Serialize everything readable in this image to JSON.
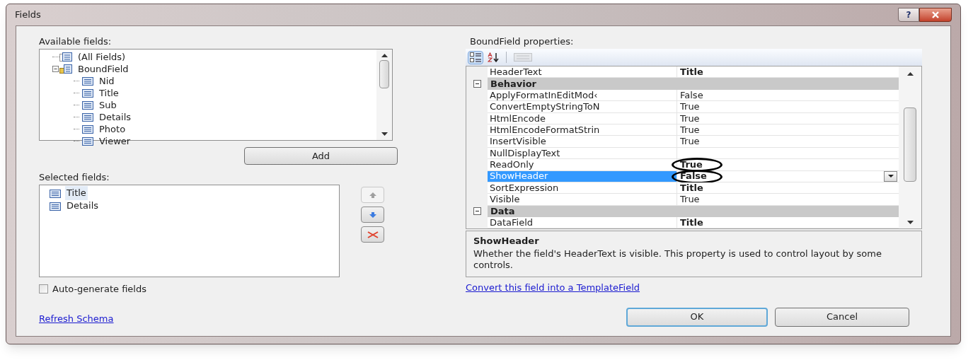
{
  "window": {
    "title": "Fields",
    "help_button": "?"
  },
  "available_fields": {
    "label": "Available fields:",
    "tree": [
      {
        "label": "(All Fields)",
        "kind": "all"
      },
      {
        "label": "BoundField",
        "kind": "folder",
        "expanded": true,
        "children": [
          {
            "label": "Nid",
            "kind": "field"
          },
          {
            "label": "Title",
            "kind": "field"
          },
          {
            "label": "Sub",
            "kind": "field"
          },
          {
            "label": "Details",
            "kind": "field"
          },
          {
            "label": "Photo",
            "kind": "field"
          },
          {
            "label": "Viewer",
            "kind": "field"
          }
        ]
      }
    ]
  },
  "add_button": "Add",
  "selected_fields": {
    "label": "Selected fields:",
    "items": [
      {
        "label": "Title",
        "selected": true
      },
      {
        "label": "Details",
        "selected": false
      }
    ]
  },
  "auto_generate": {
    "label": "Auto-generate fields",
    "checked": false
  },
  "refresh_link": "Refresh Schema",
  "properties": {
    "label": "BoundField properties:",
    "toolbar": [
      {
        "kind": "categorized",
        "selected": true
      },
      {
        "kind": "alphabetical",
        "selected": false
      }
    ],
    "rows": [
      {
        "kind": "property",
        "name": "HeaderText",
        "value": "Title",
        "modified": true,
        "selected": false
      },
      {
        "kind": "category",
        "name": "Behavior",
        "expanded": true
      },
      {
        "kind": "property",
        "name": "ApplyFormatInEditMod‹",
        "value": "False",
        "modified": false,
        "selected": false
      },
      {
        "kind": "property",
        "name": "ConvertEmptyStringToN",
        "value": "True",
        "modified": false,
        "selected": false
      },
      {
        "kind": "property",
        "name": "HtmlEncode",
        "value": "True",
        "modified": false,
        "selected": false
      },
      {
        "kind": "property",
        "name": "HtmlEncodeFormatStrin",
        "value": "True",
        "modified": false,
        "selected": false
      },
      {
        "kind": "property",
        "name": "InsertVisible",
        "value": "True",
        "modified": false,
        "selected": false
      },
      {
        "kind": "property",
        "name": "NullDisplayText",
        "selected": false
      },
      {
        "kind": "property",
        "name": "ReadOnly",
        "value": "True",
        "modified": true,
        "selected": false,
        "circled": true
      },
      {
        "kind": "property",
        "name": "ShowHeader",
        "value": "False",
        "modified": true,
        "selected": true,
        "circled": true
      },
      {
        "kind": "property",
        "name": "SortExpression",
        "value": "Title",
        "modified": true,
        "selected": false
      },
      {
        "kind": "property",
        "name": "Visible",
        "value": "True",
        "modified": false,
        "selected": false
      },
      {
        "kind": "category",
        "name": "Data",
        "expanded": true
      },
      {
        "kind": "property",
        "name": "DataField",
        "value": "Title",
        "modified": true,
        "selected": false
      }
    ],
    "description": {
      "title": "ShowHeader",
      "text": "Whether the field's HeaderText is visible.  This property is used to control layout by some controls."
    }
  },
  "convert_link": "Convert this field into a TemplateField",
  "buttons": [
    {
      "label": "OK",
      "default": true
    },
    {
      "label": "Cancel",
      "default": false
    }
  ]
}
